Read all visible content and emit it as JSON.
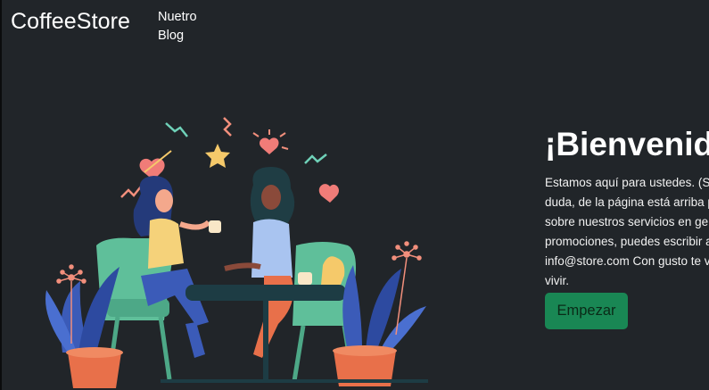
{
  "navbar": {
    "brand": "CoffeeStore",
    "links": [
      {
        "label": "Nuetro Blog"
      }
    ]
  },
  "hero": {
    "title": "¡Bienvenidos!",
    "description": "Estamos aquí para ustedes. (Si tienes alguna duda, de la página está arriba por la derecha, sobre nuestros servicios en general, horarios o promociones, puedes escribir aquí: info@store.com Con gusto te vamos a ayudar a vivir.",
    "cta_label": "Empezar",
    "illustration": "two-women-having-coffee-illustration"
  },
  "colors": {
    "background": "#212529",
    "button": "#198754",
    "button_text": "#0a2a17"
  }
}
